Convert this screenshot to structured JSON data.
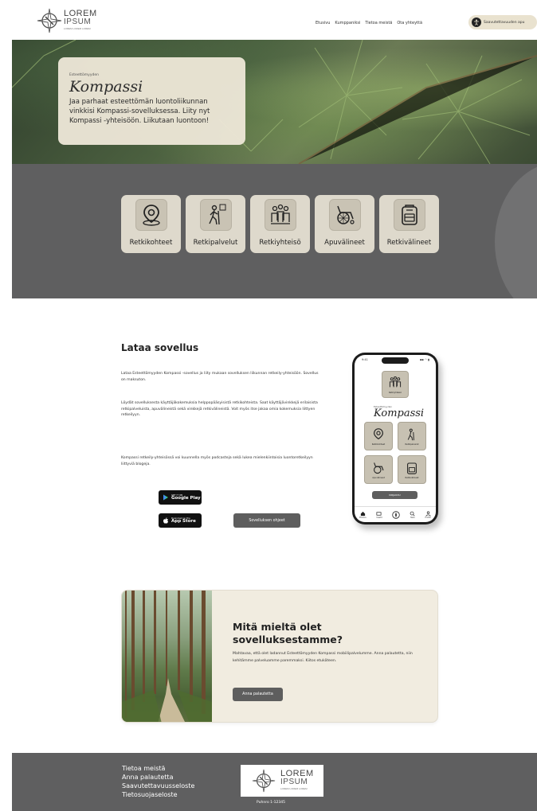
{
  "header": {
    "logo": {
      "line1": "LOREM",
      "line2": "IPSUM",
      "line3": "LOREM LOREM LOREM"
    },
    "nav": [
      "Etusivu",
      "Kumppaniksi",
      "Tietoa meistä",
      "Ota yhteyttä"
    ],
    "access_label": "Saavutettavuuden apu"
  },
  "hero": {
    "small": "Esteettömyyden",
    "title": "Kompassi",
    "text": "Jaa parhaat esteettömän luontoliikunnan vinkkisi Kompassi-sovelluksessa. Liity nyt Kompassi -yhteisöön. Liikutaan luontoon!"
  },
  "categories": [
    {
      "label": "Retkikohteet",
      "icon": "location-pin-icon"
    },
    {
      "label": "Retkipalvelut",
      "icon": "hiker-icon"
    },
    {
      "label": "Retkiyhteisö",
      "icon": "community-icon"
    },
    {
      "label": "Apuvälineet",
      "icon": "wheelchair-icon"
    },
    {
      "label": "Retkivälineet",
      "icon": "backpack-icon"
    }
  ],
  "download": {
    "title": "Lataa sovellus",
    "p1": "Lataa Esteettömyyden Kompassi -sovellus ja liity mukaan sovelluksen liikunnan retkeily-yhteisöön.  Sovellus on maksuton.",
    "p2": "Löydät sovelluksesta käyttäjäkokemuksia helppopääsyisistä retkikohteista. Saat käyttäjävinkkejä erilaisista retkipalveluista, apuvälineistä sekä vinkkejä retkivälineistä. Voit myös itse jakaa omia kokemuksia liittyen retkeilyyn.",
    "p3": "Kompassi retkeily-yhteisössä voi kuunnella myös podcasteja sekä lukea mielenkiintoisia luontoretkeilyyn liittyviä blogeja.",
    "google_small": "GET IT ON",
    "google_big": "Google Play",
    "apple_small": "Download on the",
    "apple_big": "App Store",
    "guide_label": "Sovelluksen ohjeet"
  },
  "phone": {
    "time": "9:41",
    "signal": "▪▪ ◠ ▮",
    "top_tile": "Retkiyhteisö",
    "small": "Esteettömyyden",
    "title": "Kompassi",
    "tiles": [
      "Retkikohteet",
      "Retkipalvelut",
      "Apuvälineet",
      "Retkivälineet"
    ],
    "button": "KIRJAUDU",
    "nav": [
      "Etusivu",
      "Viestit",
      "",
      "Haku",
      "Profiili"
    ]
  },
  "feedback": {
    "title": "Mitä mieltä olet sovelluksestamme?",
    "text": "Mahtavaa, että olet ladannut Esteettömyyden Kompassi mobiilipalvelumme. Anna palautetta, niin kehitämme palveluamme paremmaksi. Kiitos etukäteen.",
    "button": "Anna palautetta"
  },
  "footer": {
    "links": [
      "Tietoa meistä",
      "Anna palautetta",
      "Saavutettavuusseloste",
      "Tietosuojaseloste"
    ],
    "logo": {
      "line1": "LOREM",
      "line2": "IPSUM",
      "line3": "LOREM LOREM LOREM"
    },
    "phone": "Puhnro 1-12345"
  },
  "colors": {
    "accent": "#e9e2cf",
    "band": "#5f5f60",
    "button": "#5e5e5e",
    "tile": "#ded9cc"
  }
}
